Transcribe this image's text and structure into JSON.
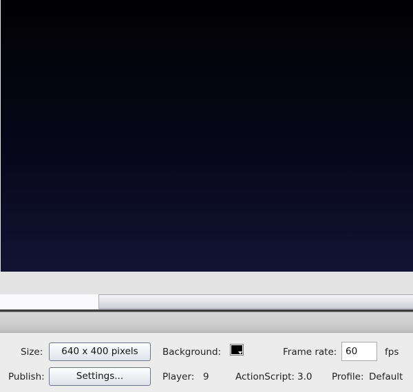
{
  "stage": {
    "background_top": "#020203",
    "background_bottom": "#121433"
  },
  "document_properties": {
    "size_label": "Size:",
    "size_button": "640 x 400 pixels",
    "background_label": "Background:",
    "background_color": "#000000",
    "frame_rate_label": "Frame rate:",
    "frame_rate_value": "60",
    "fps_unit": "fps",
    "publish_label": "Publish:",
    "settings_button": "Settings...",
    "player_label": "Player:",
    "player_value": "9",
    "actionscript_label": "ActionScript:",
    "actionscript_value": "3.0",
    "profile_label": "Profile:",
    "profile_value": "Default"
  }
}
